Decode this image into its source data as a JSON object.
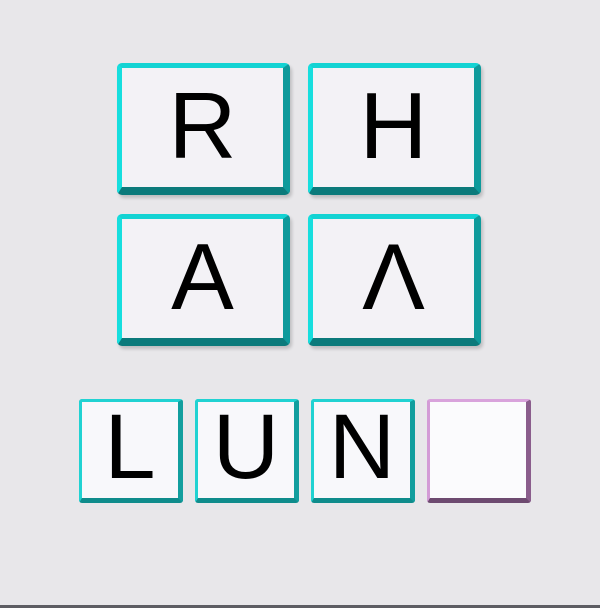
{
  "choices": [
    "R",
    "H",
    "A",
    "Λ"
  ],
  "answer_slots": [
    "L",
    "U",
    "N",
    ""
  ],
  "colors": {
    "background": "#e8e7ea",
    "tile_border": "#13d3d3",
    "tile_shadow": "#0b7a7b",
    "empty_slot_border": "#d39bd6",
    "empty_slot_shadow": "#6d4a70"
  }
}
